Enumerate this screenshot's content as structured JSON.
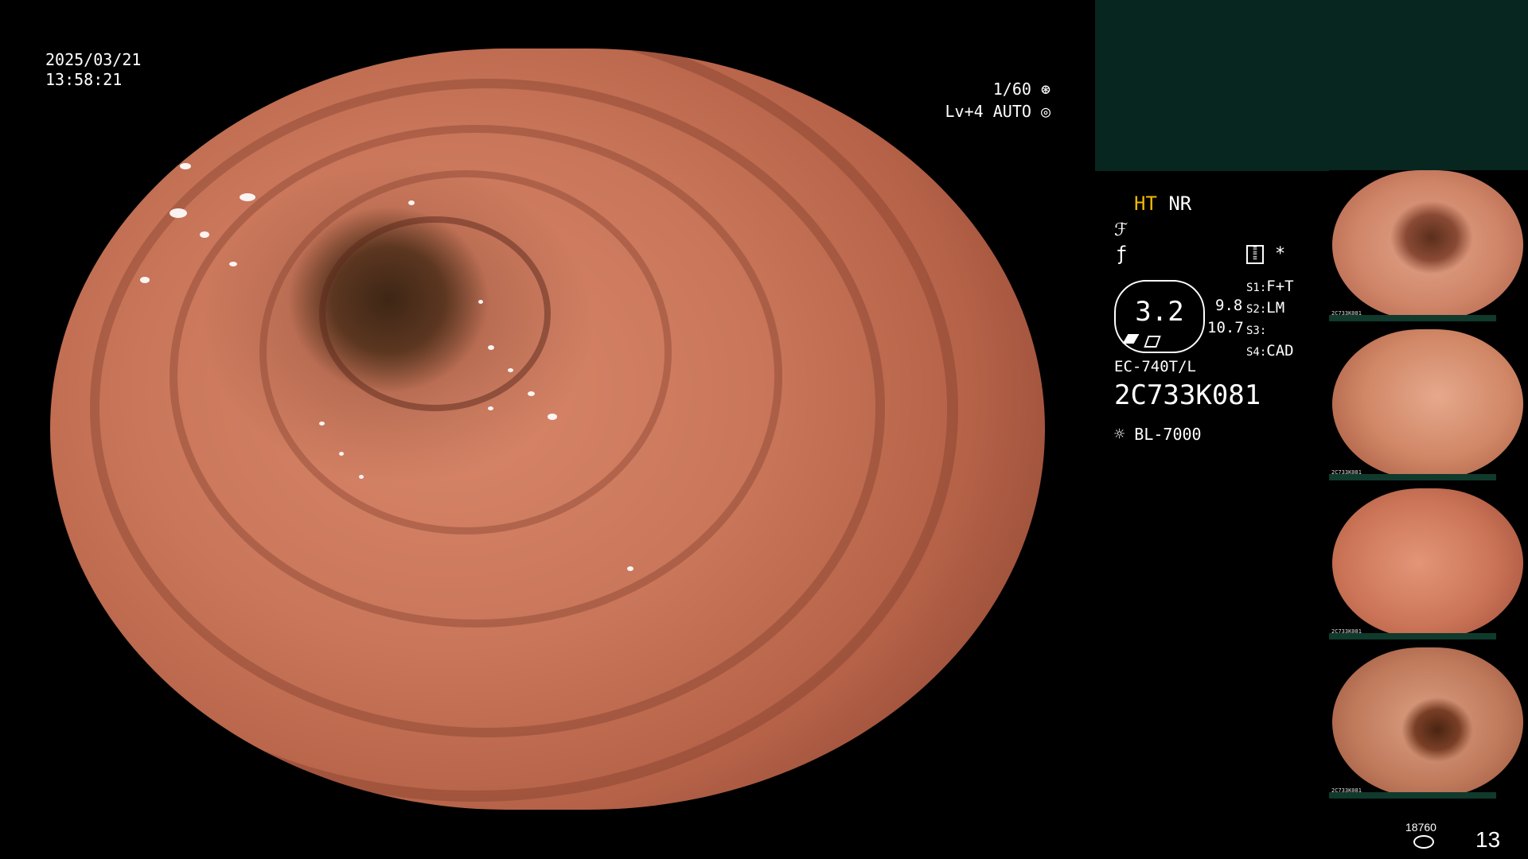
{
  "overlay": {
    "date": "2025/03/21",
    "time": "13:58:21",
    "shutter": "1/60",
    "level": "Lv+4",
    "mode": "AUTO"
  },
  "settings": {
    "ht": "HT",
    "nr": "NR",
    "value_main": "3.2",
    "value_a": "9.8",
    "value_b": "10.7",
    "s1_label": "S1:",
    "s1_value": "F+T",
    "s2_label": "S2:",
    "s2_value": "LM",
    "s3_label": "S3:",
    "s3_value": "",
    "s4_label": "S4:",
    "s4_value": "CAD",
    "asterisk": "*",
    "scope_model": "EC-740T/L",
    "scope_serial": "2C733K081",
    "light_source": "BL-7000"
  },
  "footer": {
    "storage_count": "18760",
    "image_count": "13"
  },
  "thumbnails": [
    {
      "code": "2C733K081"
    },
    {
      "code": "2C733K081"
    },
    {
      "code": "2C733K081"
    },
    {
      "code": "2C733K081"
    }
  ],
  "colors": {
    "accent_yellow": "#f5b800",
    "panel_green": "#082620",
    "tissue": "#c9765a"
  },
  "icons": [
    "shutter-icon",
    "auto-iris-icon",
    "enhance-curve-icon",
    "filter-icon",
    "memory-card-icon",
    "light-source-icon",
    "storage-icon"
  ]
}
